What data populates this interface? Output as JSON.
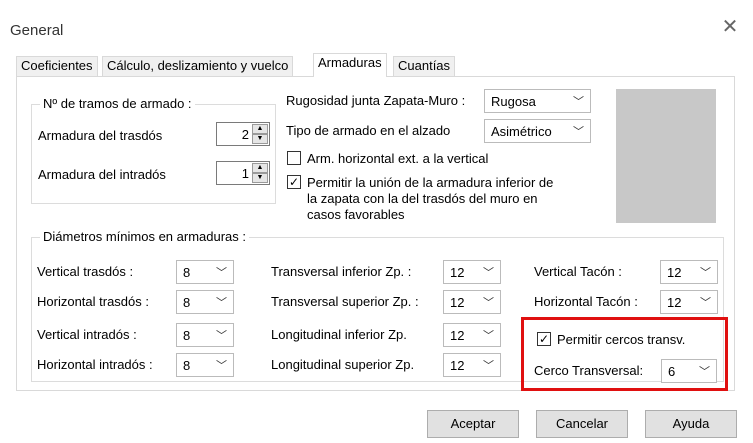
{
  "window": {
    "title": "General"
  },
  "tabs": [
    "Coeficientes",
    "Cálculo, deslizamiento y vuelco",
    "Armaduras",
    "Cuantías"
  ],
  "tramos": {
    "title": "Nº de tramos de armado :",
    "trasdos_label": "Armadura del trasdós",
    "trasdos_value": "2",
    "intrados_label": "Armadura del intradós",
    "intrados_value": "1"
  },
  "right_top": {
    "rugosidad_label": "Rugosidad junta Zapata-Muro :",
    "rugosidad_value": "Rugosa",
    "tipo_label": "Tipo de armado en el alzado",
    "tipo_value": "Asimétrico",
    "arm_horizontal_label": "Arm. horizontal ext. a la vertical",
    "arm_horizontal_checked": false,
    "permitir_union_line1": "Permitir la unión de la armadura inferior de",
    "permitir_union_line2": "la zapata con la del trasdós del muro en",
    "permitir_union_line3": "casos favorables",
    "permitir_union_checked": true
  },
  "diametros": {
    "title": "Diámetros mínimos en armaduras :",
    "col1": [
      {
        "label": "Vertical trasdós :",
        "value": "8"
      },
      {
        "label": "Horizontal trasdós :",
        "value": "8"
      },
      {
        "label": "Vertical intradós :",
        "value": "8"
      },
      {
        "label": "Horizontal intradós :",
        "value": "8"
      }
    ],
    "col2": [
      {
        "label": "Transversal inferior Zp. :",
        "value": "12"
      },
      {
        "label": "Transversal superior Zp. :",
        "value": "12"
      },
      {
        "label": "Longitudinal inferior Zp.",
        "value": "12"
      },
      {
        "label": "Longitudinal superior Zp.",
        "value": "12"
      }
    ],
    "col3": [
      {
        "label": "Vertical Tacón :",
        "value": "12"
      },
      {
        "label": "Horizontal Tacón :",
        "value": "12"
      }
    ],
    "permitir_cercos_label": "Permitir cercos transv.",
    "permitir_cercos_checked": true,
    "cerco_label": "Cerco Transversal:",
    "cerco_value": "6"
  },
  "buttons": {
    "aceptar": "Aceptar",
    "cancelar": "Cancelar",
    "ayuda": "Ayuda"
  },
  "colors": {
    "highlight": "#e01010",
    "preview": "#c8c8c8"
  }
}
